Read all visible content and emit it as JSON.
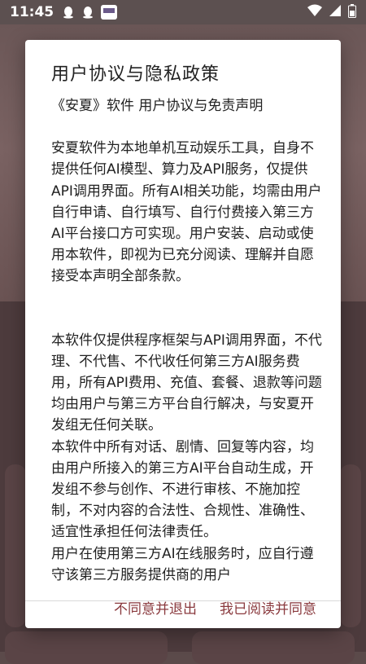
{
  "statusbar": {
    "time": "11:45",
    "icons": [
      "qq-icon",
      "qq-icon",
      "app-notification-icon"
    ],
    "right_icons": [
      "wifi-icon",
      "signal-icon",
      "battery-icon"
    ]
  },
  "dialog": {
    "title": "用户协议与隐私政策",
    "subtitle": "《安夏》软件 用户协议与免责声明",
    "paragraphs": [
      "安夏软件为本地单机互动娱乐工具，自身不提供任何AI模型、算力及API服务，仅提供API调用界面。所有AI相关功能，均需由用户自行申请、自行填写、自行付费接入第三方AI平台接口方可实现。用户安装、启动或使用本软件，即视为已充分阅读、理解并自愿接受本声明全部条款。",
      "本软件仅提供程序框架与API调用界面，不代理、不代售、不代收任何第三方AI服务费用，所有API费用、充值、套餐、退款等问题均由用户与第三方平台自行解决，与安夏开发组无任何关联。",
      "本软件中所有对话、剧情、回复等内容，均由用户所接入的第三方AI平台自动生成，开发组不参与创作、不进行审核、不施加控制，不对内容的合法性、合规性、准确性、适宜性承担任何法律责任。",
      "用户在使用第三方AI在线服务时，应自行遵守该第三方服务提供商的用户"
    ],
    "decline_label": "不同意并退出",
    "accept_label": "我已阅读并同意"
  },
  "colors": {
    "accent": "#8a3a3e",
    "statusbar_bg": "#5c5050",
    "scrim_bg": "#5b4a4a"
  }
}
